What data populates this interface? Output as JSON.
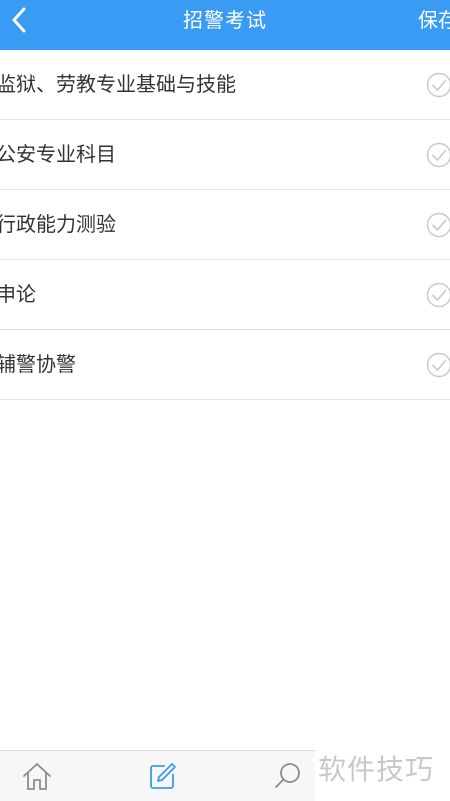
{
  "nav": {
    "title": "招警考试",
    "save_label": "保存",
    "back_icon": "chevron-left-icon"
  },
  "subjects": [
    {
      "label": "监狱、劳教专业基础与技能",
      "selected": false
    },
    {
      "label": "公安专业科目",
      "selected": false
    },
    {
      "label": "行政能力测验",
      "selected": false
    },
    {
      "label": "申论",
      "selected": false
    },
    {
      "label": "辅警协警",
      "selected": false
    }
  ],
  "tab_bar": {
    "items": [
      "home-icon",
      "edit-icon",
      "search-icon"
    ]
  },
  "watermark": "软件技巧",
  "colors": {
    "nav_background": "#3a9bf4",
    "check_gray": "#c9c9c9",
    "tab_icon_default": "#8c8c8c",
    "tab_icon_active": "#3a9bf4"
  }
}
